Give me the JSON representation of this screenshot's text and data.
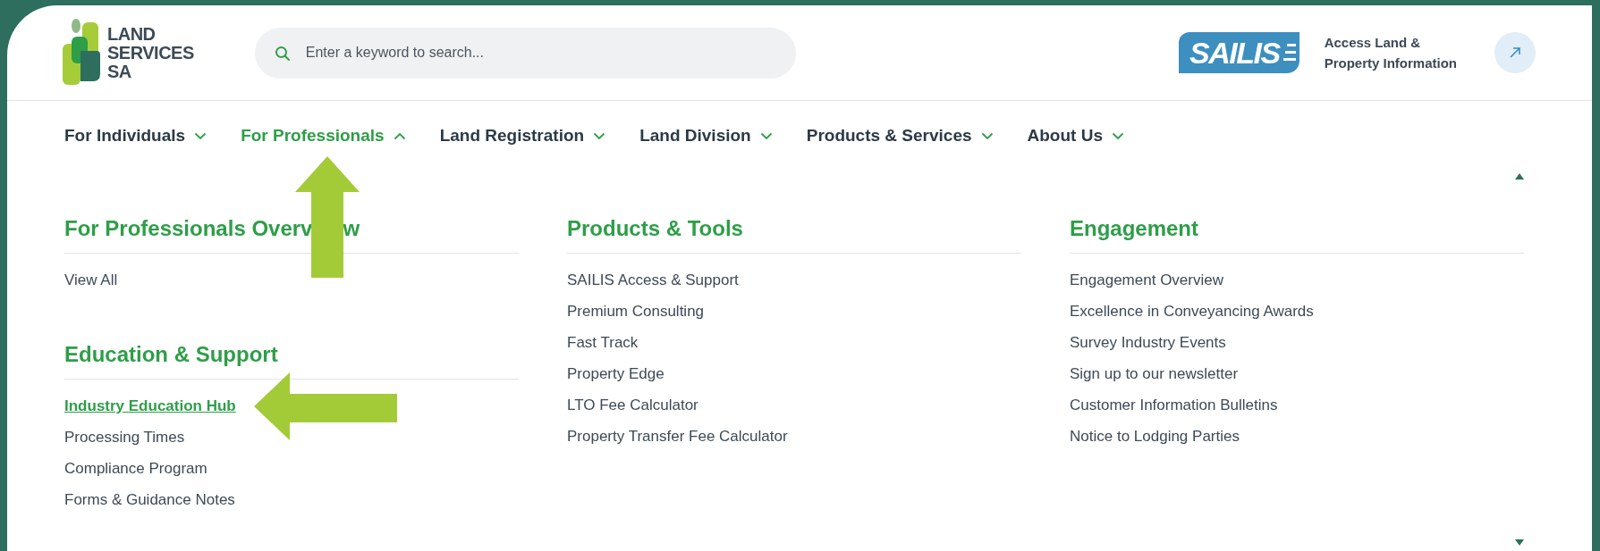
{
  "header": {
    "logo": {
      "lines": [
        "LAND",
        "SERVICES",
        "SA"
      ]
    },
    "search": {
      "placeholder": "Enter a keyword to search..."
    },
    "sailis": {
      "logo_text": "SAILIS",
      "lines": [
        "Access Land &",
        "Property Information"
      ]
    }
  },
  "nav": [
    {
      "label": "For Individuals",
      "expanded": false,
      "pointed_at": false
    },
    {
      "label": "For Professionals",
      "expanded": true,
      "pointed_at": true
    },
    {
      "label": "Land Registration",
      "expanded": false,
      "pointed_at": false
    },
    {
      "label": "Land Division",
      "expanded": false,
      "pointed_at": false
    },
    {
      "label": "Products & Services",
      "expanded": false,
      "pointed_at": false
    },
    {
      "label": "About Us",
      "expanded": false,
      "pointed_at": false
    }
  ],
  "menu": {
    "columns": [
      {
        "sections": [
          {
            "title": [
              "For Professionals Overv",
              "w"
            ],
            "links": [
              {
                "label": "View All",
                "highlighted": false,
                "pointed_at": false
              }
            ]
          },
          {
            "title": [
              "Education & Support"
            ],
            "links": [
              {
                "label": "Industry Education Hub",
                "highlighted": true,
                "pointed_at": true
              },
              {
                "label": "Processing Times",
                "highlighted": false,
                "pointed_at": false
              },
              {
                "label": "Compliance Program",
                "highlighted": false,
                "pointed_at": false
              },
              {
                "label": "Forms & Guidance Notes",
                "highlighted": false,
                "pointed_at": false
              }
            ]
          }
        ]
      },
      {
        "sections": [
          {
            "title": [
              "Products & Tools"
            ],
            "links": [
              {
                "label": "SAILIS Access & Support",
                "highlighted": false,
                "pointed_at": false
              },
              {
                "label": "Premium Consulting",
                "highlighted": false,
                "pointed_at": false
              },
              {
                "label": "Fast Track",
                "highlighted": false,
                "pointed_at": false
              },
              {
                "label": "Property Edge",
                "highlighted": false,
                "pointed_at": false
              },
              {
                "label": "LTO Fee Calculator",
                "highlighted": false,
                "pointed_at": false
              },
              {
                "label": "Property Transfer Fee Calculator",
                "highlighted": false,
                "pointed_at": false
              }
            ]
          }
        ]
      },
      {
        "sections": [
          {
            "title": [
              "Engagement"
            ],
            "links": [
              {
                "label": "Engagement Overview",
                "highlighted": false,
                "pointed_at": false
              },
              {
                "label": "Excellence in Conveyancing Awards",
                "highlighted": false,
                "pointed_at": false
              },
              {
                "label": "Survey Industry Events",
                "highlighted": false,
                "pointed_at": false
              },
              {
                "label": "Sign up to our newsletter",
                "highlighted": false,
                "pointed_at": false
              },
              {
                "label": "Customer Information Bulletins",
                "highlighted": false,
                "pointed_at": false
              },
              {
                "label": "Notice to Lodging Parties",
                "highlighted": false,
                "pointed_at": false
              }
            ]
          }
        ]
      }
    ]
  }
}
